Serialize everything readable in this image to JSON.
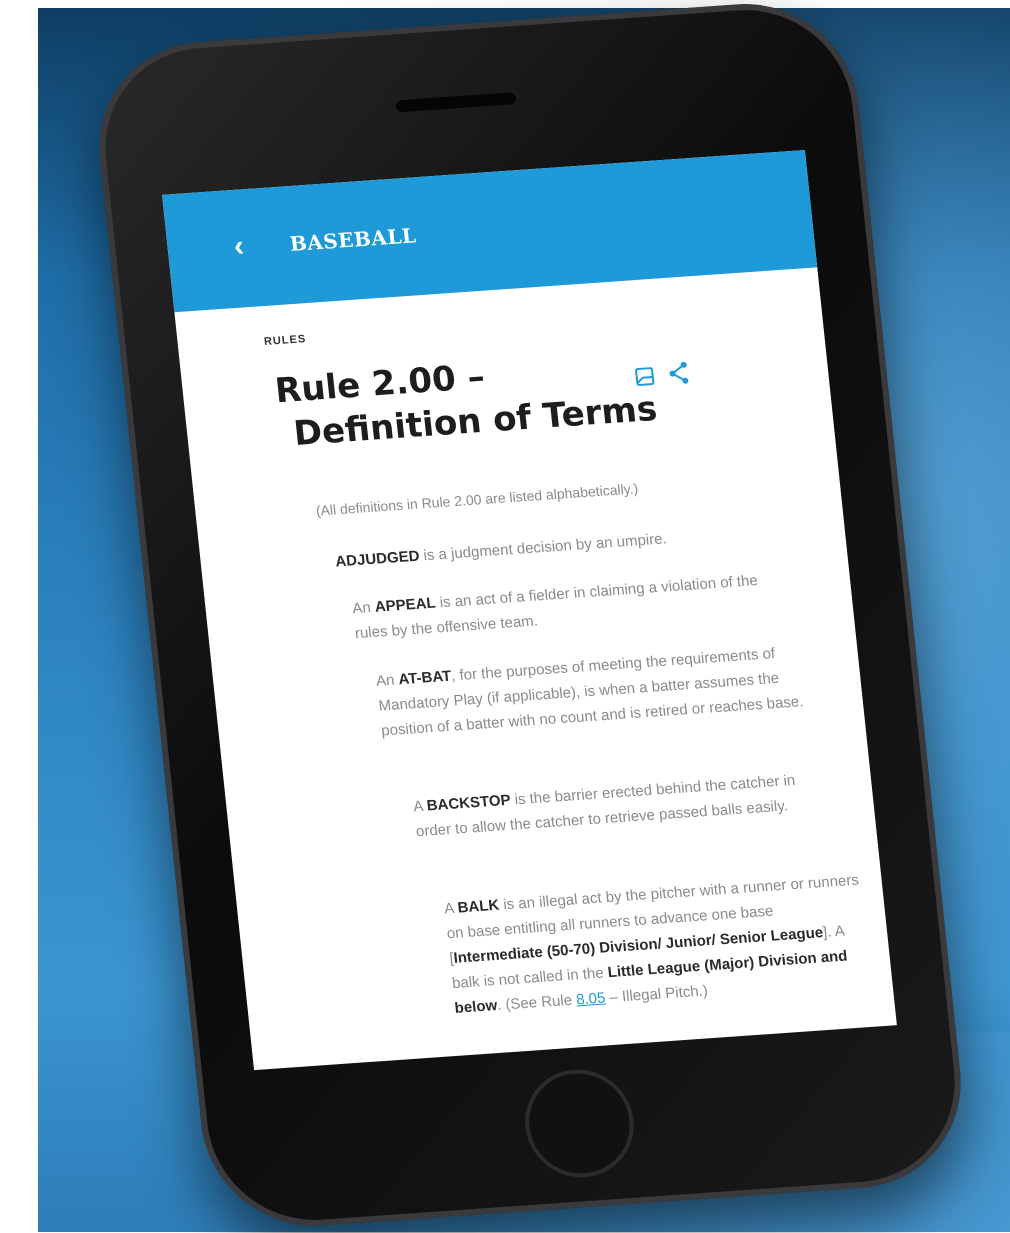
{
  "appbar": {
    "back_icon": "chevron-left-icon",
    "title": "BASEBALL",
    "color": "#1e9ad8"
  },
  "article": {
    "section_label": "RULES",
    "title_line1": "Rule 2.00 –",
    "title_line2": "Definition of Terms",
    "actions": [
      "bookmark-icon",
      "share-icon"
    ]
  },
  "definitions": {
    "intro": "(All definitions in Rule 2.00 are listed alphabetically.)",
    "adjudged": {
      "term": "ADJUDGED",
      "text": " is a judgment decision by an umpire."
    },
    "appeal": {
      "prefix": "An ",
      "term": "APPEAL",
      "text": " is an act of a fielder in claiming a violation of the rules by the offensive team."
    },
    "at_bat": {
      "prefix": "An ",
      "term": "AT-BAT",
      "text": ", for the purposes of meeting the requirements of Mandatory Play (if applicable), is when a batter assumes the position of a batter with no count and is retired or reaches base."
    },
    "backstop": {
      "prefix": "A ",
      "term": "BACKSTOP",
      "text": " is the barrier erected behind the catcher in order to allow the catcher to retrieve passed balls easily."
    },
    "balk": {
      "prefix": "A ",
      "term": "BALK",
      "text1": " is an illegal act by the pitcher with a runner or runners on base entitling all runners to advance one base [",
      "bold1": "Intermediate (50-70) Division/ Junior/ Senior League",
      "text2": "]. A balk is not called in the ",
      "bold2": "Little League (Major) Division and below",
      "text3": ". (See Rule ",
      "link": "8.05",
      "text4": " – Illegal Pitch.)"
    }
  }
}
